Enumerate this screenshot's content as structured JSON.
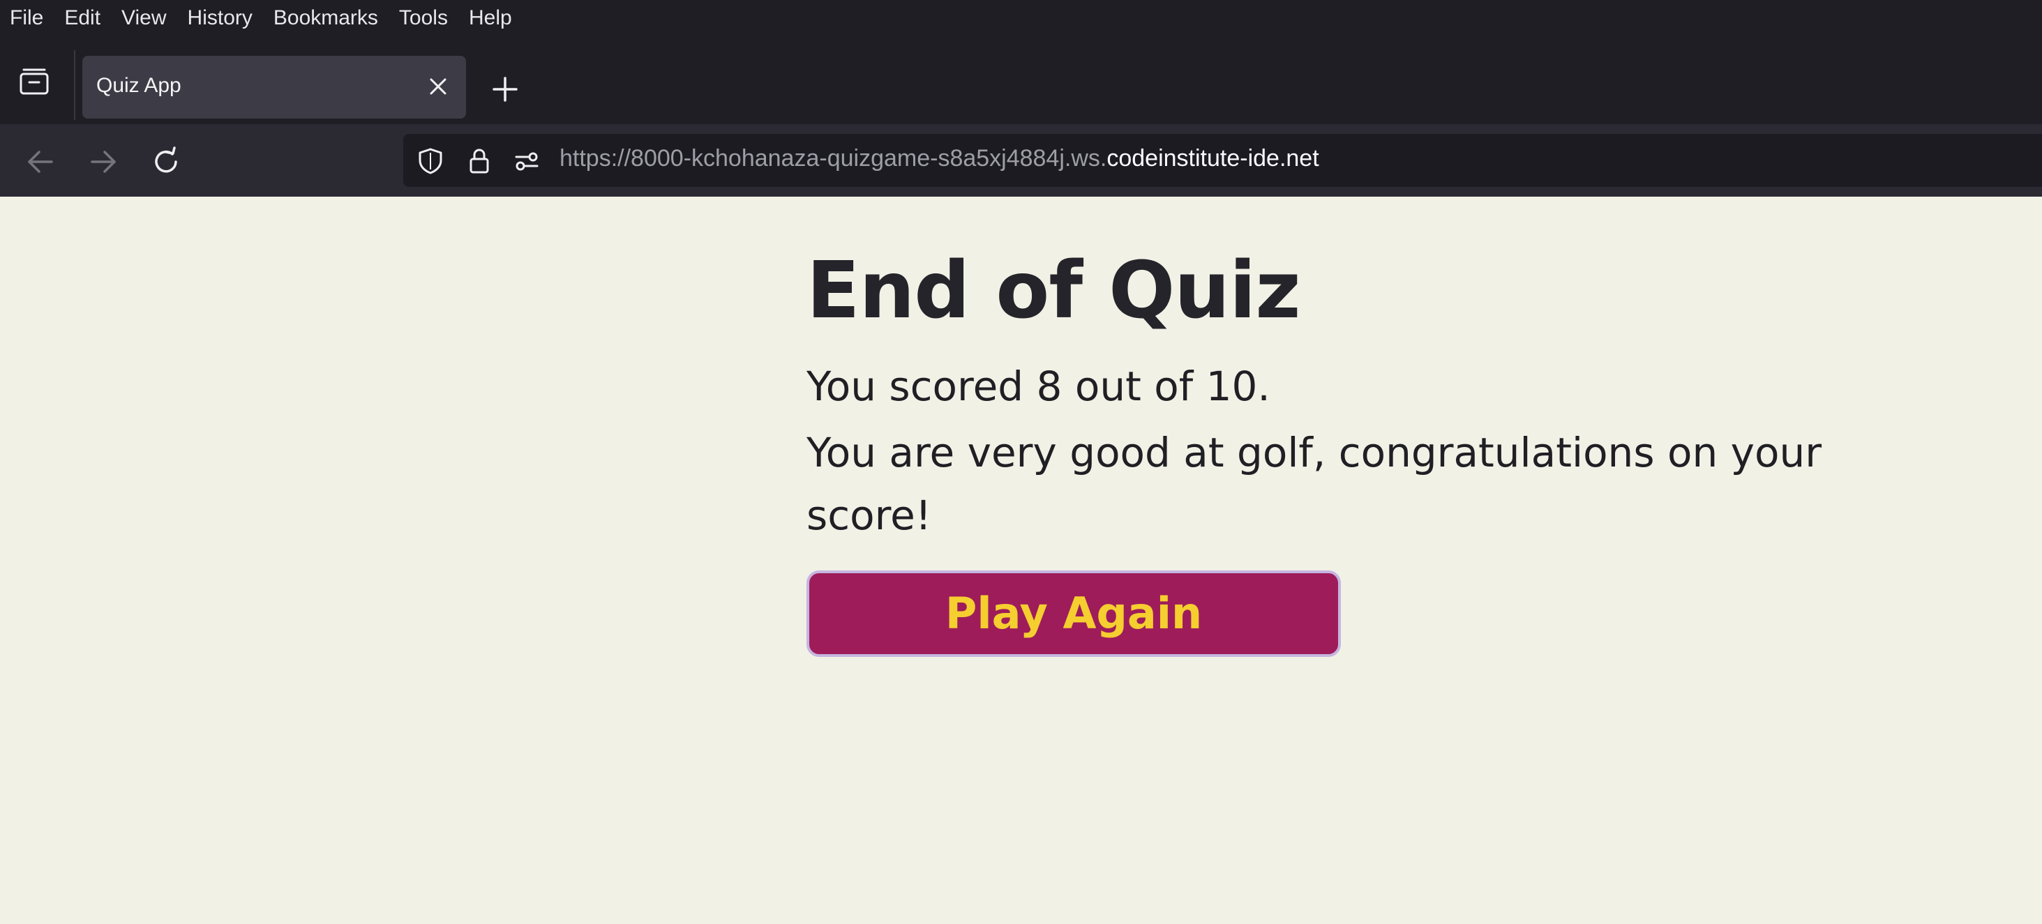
{
  "browser": {
    "menu": [
      {
        "label": "File"
      },
      {
        "label": "Edit"
      },
      {
        "label": "View"
      },
      {
        "label": "History"
      },
      {
        "label": "Bookmarks"
      },
      {
        "label": "Tools"
      },
      {
        "label": "Help"
      }
    ],
    "tab": {
      "title": "Quiz App"
    },
    "url": {
      "prefix": "https://8000-kchohanaza-quizgame-s8a5xj4884j.ws.",
      "host": "codeinstitute-ide.net"
    }
  },
  "page": {
    "heading": "End of Quiz",
    "score_text": "You scored 8 out of 10.",
    "message": "You are very good at golf, congratulations on your score!",
    "button_label": "Play Again"
  },
  "colors": {
    "page_background": "#f2f1e6",
    "button_background": "#9e1c5a",
    "button_text": "#f5ce2f",
    "chrome_dark": "#1f1e25"
  }
}
